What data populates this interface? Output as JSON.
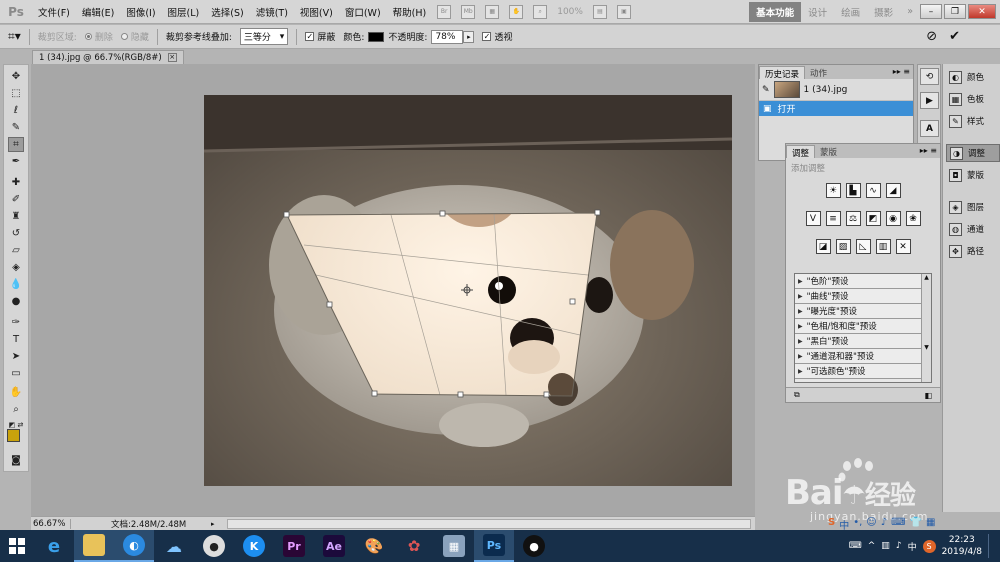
{
  "app": {
    "logo": "Ps"
  },
  "menu": [
    "文件(F)",
    "编辑(E)",
    "图像(I)",
    "图层(L)",
    "选择(S)",
    "滤镜(T)",
    "视图(V)",
    "窗口(W)",
    "帮助(H)"
  ],
  "menubar": {
    "zoom": "100%",
    "workspaces": [
      "基本功能",
      "设计",
      "绘画",
      "摄影"
    ],
    "more": "»"
  },
  "options": {
    "crop_area_label": "裁剪区域:",
    "delete_label": "删除",
    "hide_label": "隐藏",
    "overlay_label": "裁剪参考线叠加:",
    "overlay_value": "三等分",
    "shield_label": "屏蔽",
    "color_label": "颜色:",
    "opacity_label": "不透明度:",
    "opacity_value": "78%",
    "perspective_label": "透视"
  },
  "document": {
    "tab_title": "1 (34).jpg @ 66.7%(RGB/8#)",
    "zoom": "66.67%",
    "docinfo": "文档:2.48M/2.48M"
  },
  "history_panel": {
    "tabs": [
      "历史记录",
      "动作"
    ],
    "snapshot": "1 (34).jpg",
    "state": "打开"
  },
  "adjust_panel": {
    "tabs": [
      "调整",
      "蒙版"
    ],
    "hint": "添加调整",
    "presets": [
      "\"色阶\"预设",
      "\"曲线\"预设",
      "\"曝光度\"预设",
      "\"色相/饱和度\"预设",
      "\"黑白\"预设",
      "\"通道混和器\"预设",
      "\"可选颜色\"预设"
    ]
  },
  "right_dock": {
    "group1": [
      "颜色",
      "色板",
      "样式"
    ],
    "group2": [
      "调整",
      "蒙版"
    ],
    "group3": [
      "图层",
      "通道",
      "路径"
    ]
  },
  "taskbar": {
    "apps": [
      "ie-icon",
      "file-explorer-icon",
      "browser-icon",
      "baidu-netdisk-icon",
      "panda-app-icon",
      "k-app-icon",
      "premiere-icon",
      "after-effects-icon",
      "paint-icon",
      "media-icon",
      "calculator-icon",
      "photoshop-icon",
      "qq-icon"
    ],
    "app_labels": {
      "premiere": "Pr",
      "after_effects": "Ae",
      "photoshop": "Ps"
    },
    "tray_lang": "中",
    "time": "22:23",
    "date": "2019/4/8"
  },
  "watermark": {
    "brand": "Bai",
    "brand2": "经验",
    "url": "jingyan.baidu.com"
  },
  "colors": {
    "foreground": "#c9a20c",
    "background": "#ffffff",
    "selection": "#3b8fd6",
    "taskbar": "#172f49"
  }
}
